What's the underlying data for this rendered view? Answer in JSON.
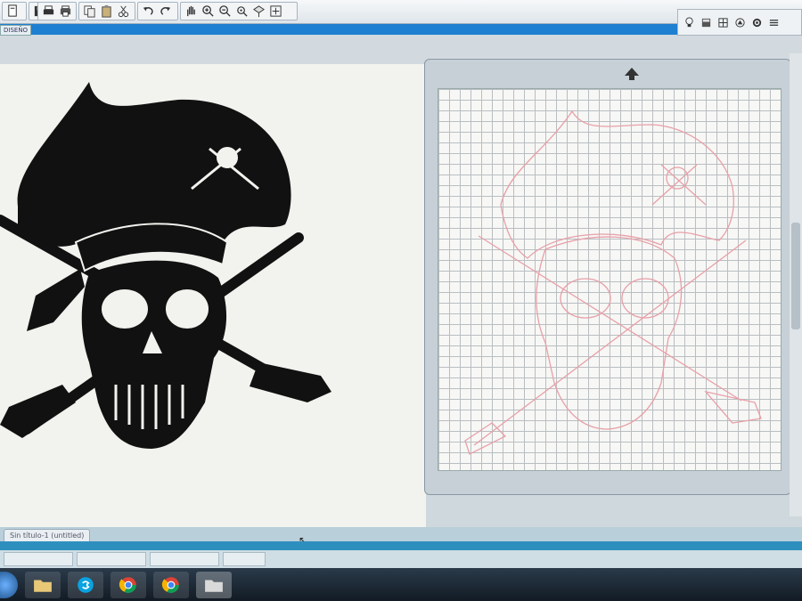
{
  "toolbar": {
    "icons": [
      "new-icon",
      "save-icon",
      "print-icon",
      "print-preview-icon",
      "copy-icon",
      "paste-icon",
      "cut-icon",
      "undo-icon",
      "redo-icon",
      "pan-hand-icon",
      "zoom-in-icon",
      "zoom-out-icon",
      "zoom-fit-icon",
      "zoom-select-icon",
      "zoom-all-icon"
    ]
  },
  "design_tab": {
    "label": "DISEÑO"
  },
  "right_tools": {
    "icons": [
      "lamp-icon",
      "page-icon",
      "grid-icon",
      "shapes-icon",
      "settings-icon",
      "lines-icon"
    ]
  },
  "document_tab": {
    "label": "Sin título-1 (untitled)"
  },
  "cutting_mat": {
    "arrow": "feed-up-arrow"
  },
  "taskbar": {
    "apps": [
      "start-icon",
      "file-explorer-icon",
      "skype-icon",
      "chrome-icon",
      "chrome-icon",
      "folder-icon"
    ]
  },
  "colors": {
    "toolbar_bg": "#e9edf0",
    "accent_blue": "#1f7fd0",
    "mat_bg": "#c7d0d6",
    "cut_line": "#e7a0a8",
    "design_fill": "#111111"
  }
}
